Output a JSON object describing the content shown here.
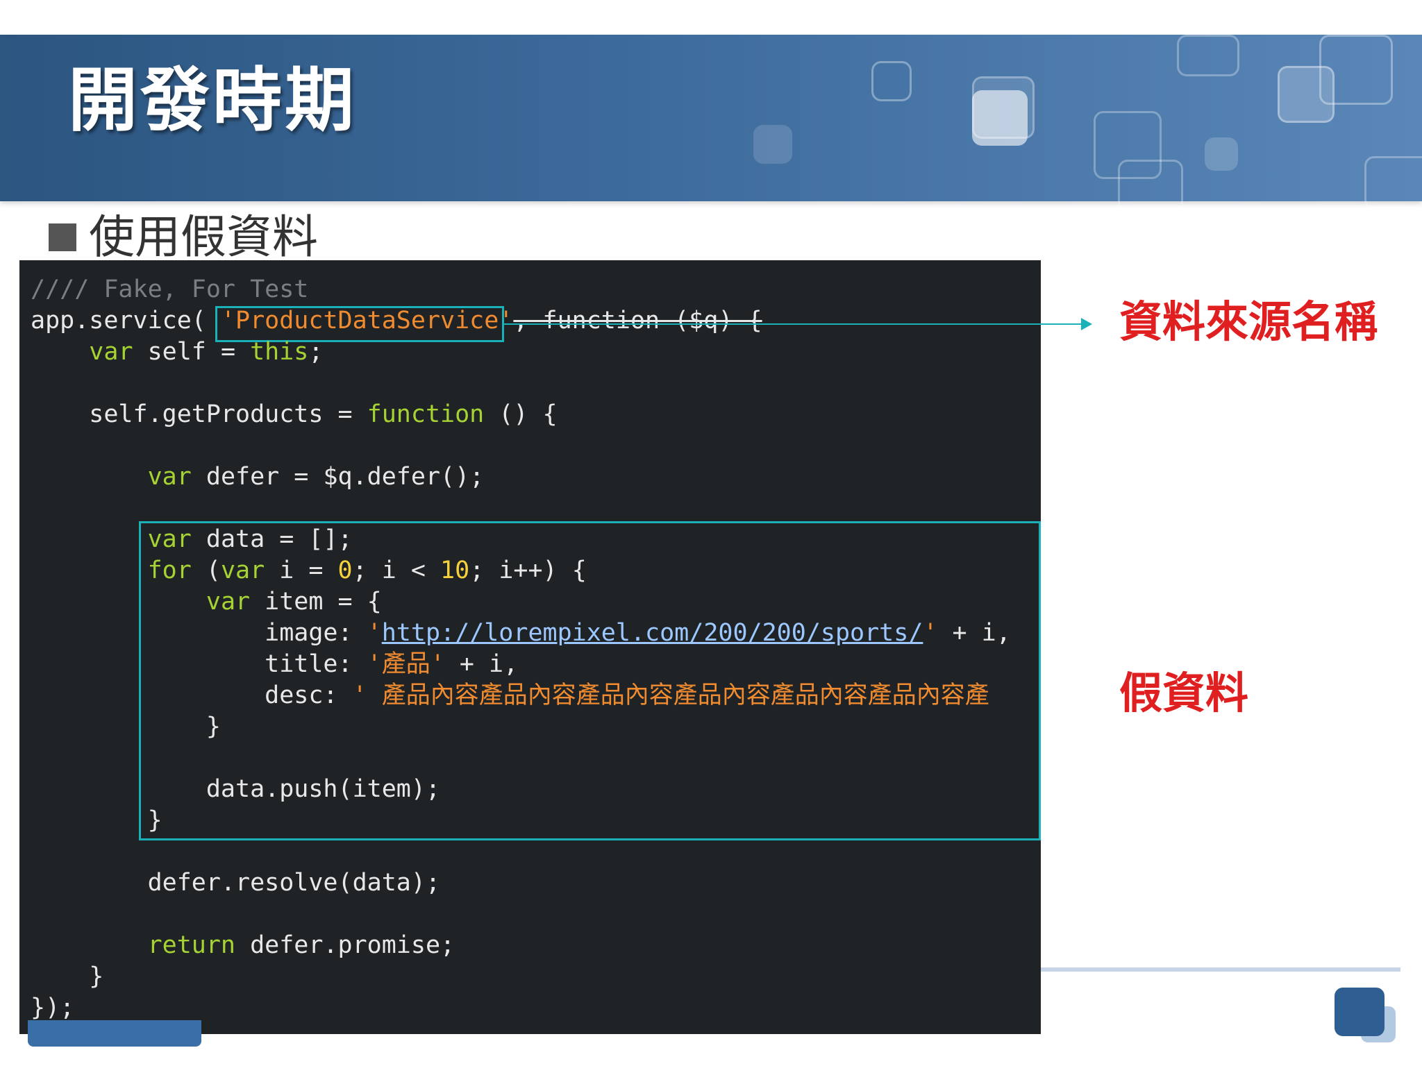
{
  "slide": {
    "title": "開發時期",
    "bullet": "使用假資料"
  },
  "callouts": {
    "service_name": "資料來源名稱",
    "fake_data": "假資料"
  },
  "code_lines": [
    [
      {
        "t": "//// Fake, For Test",
        "c": "cmt"
      }
    ],
    [
      {
        "t": "app.service( ",
        "c": ""
      },
      {
        "t": "'ProductDataService'",
        "c": "str"
      },
      {
        "t": ", function ($q) {",
        "c": "strike"
      }
    ],
    [
      {
        "t": "    ",
        "c": ""
      },
      {
        "t": "var",
        "c": "kw"
      },
      {
        "t": " self = ",
        "c": ""
      },
      {
        "t": "this",
        "c": "kw"
      },
      {
        "t": ";",
        "c": ""
      }
    ],
    [
      {
        "t": "",
        "c": ""
      }
    ],
    [
      {
        "t": "    self.getProducts = ",
        "c": ""
      },
      {
        "t": "function",
        "c": "kw"
      },
      {
        "t": " () {",
        "c": ""
      }
    ],
    [
      {
        "t": "",
        "c": ""
      }
    ],
    [
      {
        "t": "        ",
        "c": ""
      },
      {
        "t": "var",
        "c": "kw"
      },
      {
        "t": " defer = $q.defer();",
        "c": ""
      }
    ],
    [
      {
        "t": "",
        "c": ""
      }
    ],
    [
      {
        "t": "        ",
        "c": ""
      },
      {
        "t": "var",
        "c": "kw"
      },
      {
        "t": " data = [];",
        "c": ""
      }
    ],
    [
      {
        "t": "        ",
        "c": ""
      },
      {
        "t": "for",
        "c": "kw"
      },
      {
        "t": " (",
        "c": ""
      },
      {
        "t": "var",
        "c": "kw"
      },
      {
        "t": " i = ",
        "c": ""
      },
      {
        "t": "0",
        "c": "num"
      },
      {
        "t": "; i < ",
        "c": ""
      },
      {
        "t": "10",
        "c": "num"
      },
      {
        "t": "; i++) {",
        "c": ""
      }
    ],
    [
      {
        "t": "            ",
        "c": ""
      },
      {
        "t": "var",
        "c": "kw"
      },
      {
        "t": " item = {",
        "c": ""
      }
    ],
    [
      {
        "t": "                image: ",
        "c": ""
      },
      {
        "t": "'",
        "c": "str"
      },
      {
        "t": "http://lorempixel.com/200/200/sports/",
        "c": "url"
      },
      {
        "t": "'",
        "c": "str"
      },
      {
        "t": " + i,",
        "c": ""
      }
    ],
    [
      {
        "t": "                title: ",
        "c": ""
      },
      {
        "t": "'產品'",
        "c": "str"
      },
      {
        "t": " + i,",
        "c": ""
      }
    ],
    [
      {
        "t": "                desc: ",
        "c": ""
      },
      {
        "t": "' 產品內容產品內容產品內容產品內容產品內容產品內容產",
        "c": "str"
      }
    ],
    [
      {
        "t": "            }",
        "c": ""
      }
    ],
    [
      {
        "t": "",
        "c": ""
      }
    ],
    [
      {
        "t": "            data.push(item);",
        "c": ""
      }
    ],
    [
      {
        "t": "        }",
        "c": ""
      }
    ],
    [
      {
        "t": "",
        "c": ""
      }
    ],
    [
      {
        "t": "        defer.resolve(data);",
        "c": ""
      }
    ],
    [
      {
        "t": "",
        "c": ""
      }
    ],
    [
      {
        "t": "        ",
        "c": ""
      },
      {
        "t": "return",
        "c": "kw"
      },
      {
        "t": " defer.promise;",
        "c": ""
      }
    ],
    [
      {
        "t": "    }",
        "c": ""
      }
    ],
    [
      {
        "t": "});",
        "c": ""
      }
    ]
  ]
}
